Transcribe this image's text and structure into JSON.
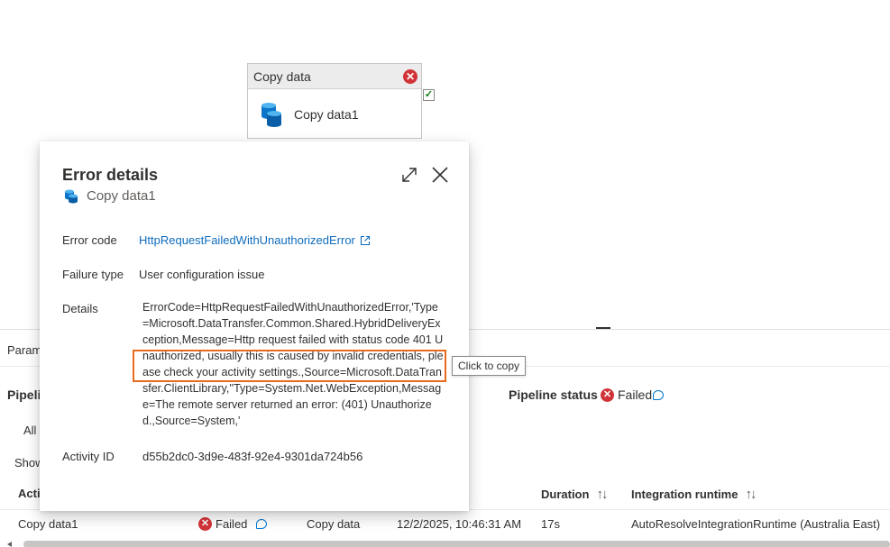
{
  "canvas": {
    "activity_type": "Copy data",
    "activity_name": "Copy data1",
    "error_badge": "✕",
    "success_check": "✓"
  },
  "bottom_panel": {
    "params_tab": "Param",
    "pipeline_run_label": "Pipeli",
    "pipeline_status_label": "Pipeline status",
    "pipeline_status_value": "Failed",
    "all_tab": "All",
    "show_label": "Show",
    "columns": {
      "activity": "Activ",
      "duration": "Duration",
      "integration_runtime": "Integration runtime"
    },
    "row": {
      "activity_name": "Copy data1",
      "status": "Failed",
      "activity_type": "Copy data",
      "run_start": "12/2/2025, 10:46:31 AM",
      "duration": "17s",
      "integration_runtime": "AutoResolveIntegrationRuntime (Australia East)"
    }
  },
  "error_details": {
    "title": "Error details",
    "activity_name": "Copy data1",
    "error_code_label": "Error code",
    "error_code_value": "HttpRequestFailedWithUnauthorizedError",
    "failure_type_label": "Failure type",
    "failure_type_value": "User configuration issue",
    "details_label": "Details",
    "details_value": " ErrorCode=HttpRequestFailedWithUnauthorizedError,'Type=Microsoft.DataTransfer.Common.Shared.HybridDeliveryException,Message=Http request failed with status code 401 Unauthorized, usually this is caused by invalid credentials, please check your activity settings.,Source=Microsoft.DataTransfer.ClientLibrary,''Type=System.Net.WebException,Message=The remote server returned an error: (401) Unauthorized.,Source=System,'",
    "activity_id_label": "Activity ID",
    "activity_id_value": "d55b2dc0-3d9e-483f-92e4-9301da724b56",
    "tooltip": "Click to copy"
  },
  "icons": {
    "expand": "expand-icon",
    "close": "close-icon",
    "external_link": "external-link-icon",
    "database": "database-icon"
  },
  "colors": {
    "error_red": "#d13438",
    "link_blue": "#0f6cbd",
    "highlight_orange": "#e86a1d"
  }
}
